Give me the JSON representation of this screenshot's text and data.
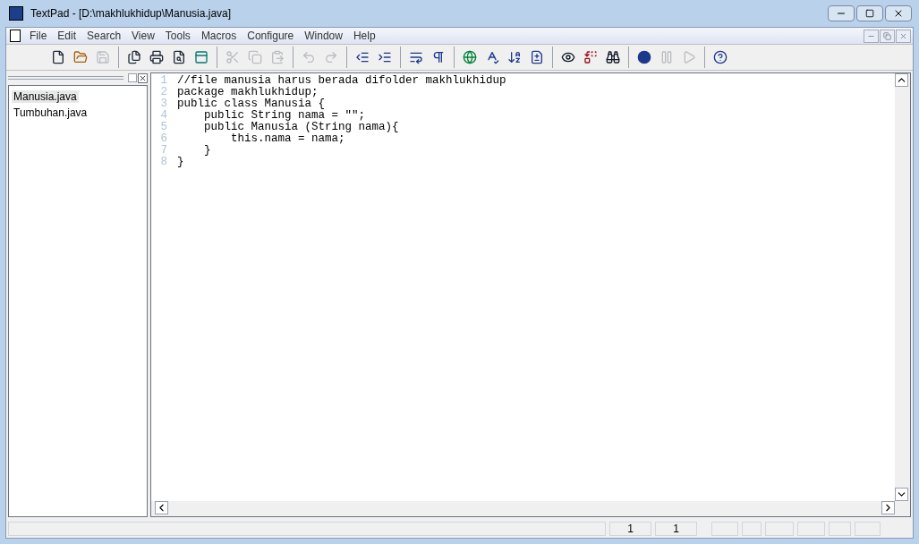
{
  "window": {
    "title": "TextPad - [D:\\makhlukhidup\\Manusia.java]"
  },
  "menu": [
    "File",
    "Edit",
    "Search",
    "View",
    "Tools",
    "Macros",
    "Configure",
    "Window",
    "Help"
  ],
  "toolbar": [
    {
      "kind": "new",
      "disabled": false
    },
    {
      "kind": "open",
      "disabled": false
    },
    {
      "kind": "save",
      "disabled": true
    },
    {
      "kind": "sep"
    },
    {
      "kind": "documents",
      "disabled": false
    },
    {
      "kind": "print",
      "disabled": false
    },
    {
      "kind": "preview",
      "disabled": false
    },
    {
      "kind": "window",
      "disabled": false
    },
    {
      "kind": "sep"
    },
    {
      "kind": "cut",
      "disabled": true
    },
    {
      "kind": "copy",
      "disabled": true
    },
    {
      "kind": "paste",
      "disabled": true
    },
    {
      "kind": "sep"
    },
    {
      "kind": "undo",
      "disabled": true
    },
    {
      "kind": "redo",
      "disabled": true
    },
    {
      "kind": "sep"
    },
    {
      "kind": "outdent",
      "disabled": false
    },
    {
      "kind": "indent",
      "disabled": false
    },
    {
      "kind": "sep"
    },
    {
      "kind": "wrap",
      "disabled": false
    },
    {
      "kind": "pilcrow",
      "disabled": false
    },
    {
      "kind": "sep"
    },
    {
      "kind": "globe",
      "disabled": false
    },
    {
      "kind": "spell",
      "disabled": false
    },
    {
      "kind": "sort",
      "disabled": false
    },
    {
      "kind": "compare",
      "disabled": false
    },
    {
      "kind": "sep"
    },
    {
      "kind": "find",
      "disabled": false
    },
    {
      "kind": "replace",
      "disabled": false
    },
    {
      "kind": "findfiles",
      "disabled": false
    },
    {
      "kind": "sep"
    },
    {
      "kind": "record",
      "disabled": false
    },
    {
      "kind": "pause",
      "disabled": true
    },
    {
      "kind": "play",
      "disabled": true
    },
    {
      "kind": "sep"
    },
    {
      "kind": "help",
      "disabled": false
    }
  ],
  "files": [
    {
      "name": "Manusia.java",
      "selected": true
    },
    {
      "name": "Tumbuhan.java",
      "selected": false
    }
  ],
  "code": [
    {
      "number": "1",
      "text": "//file manusia harus berada difolder makhlukhidup"
    },
    {
      "number": "2",
      "text": "package makhlukhidup;"
    },
    {
      "number": "3",
      "text": "public class Manusia {"
    },
    {
      "number": "4",
      "text": "    public String nama = \"\";"
    },
    {
      "number": "5",
      "text": "    public Manusia (String nama){"
    },
    {
      "number": "6",
      "text": "        this.nama = nama;"
    },
    {
      "number": "7",
      "text": "    }"
    },
    {
      "number": "8",
      "text": "}"
    }
  ],
  "status_bar": {
    "line": "1",
    "column": "1"
  }
}
